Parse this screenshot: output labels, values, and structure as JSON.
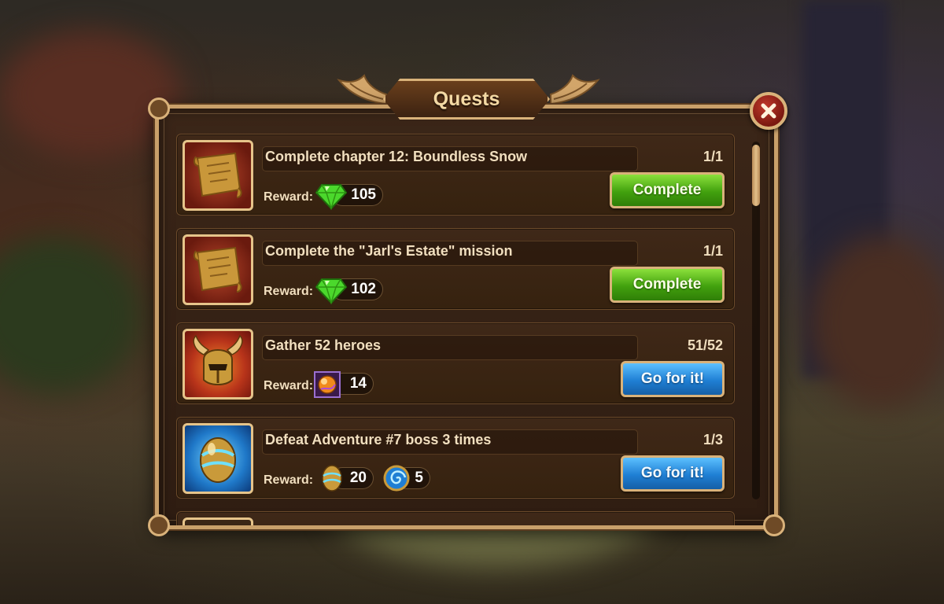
{
  "dialog": {
    "title": "Quests",
    "close_icon": "close-x-icon"
  },
  "reward_label": "Reward:",
  "colors": {
    "complete_button": "#42a10e",
    "go_button": "#1f7fd4",
    "frame_gold": "#d9b27a",
    "panel_bg": "#3b2618"
  },
  "quests": [
    {
      "title": "Complete chapter 12: Boundless Snow",
      "progress": "1/1",
      "icon": "scroll-map-icon",
      "rewards": [
        {
          "icon": "emerald-gem-icon",
          "amount": "105"
        }
      ],
      "button": "Complete"
    },
    {
      "title": "Complete the \"Jarl's Estate\" mission",
      "progress": "1/1",
      "icon": "scroll-map-icon",
      "rewards": [
        {
          "icon": "emerald-gem-icon",
          "amount": "102"
        }
      ],
      "button": "Complete"
    },
    {
      "title": "Gather 52 heroes",
      "progress": "51/52",
      "icon": "winged-helmet-icon",
      "rewards": [
        {
          "icon": "energy-orb-icon",
          "amount": "14"
        }
      ],
      "button": "Go for it!"
    },
    {
      "title": "Defeat Adventure #7 boss 3 times",
      "progress": "1/3",
      "icon": "golden-egg-icon",
      "rewards": [
        {
          "icon": "golden-egg-icon",
          "amount": "20"
        },
        {
          "icon": "blue-swirl-icon",
          "amount": "5"
        }
      ],
      "button": "Go for it!"
    }
  ]
}
